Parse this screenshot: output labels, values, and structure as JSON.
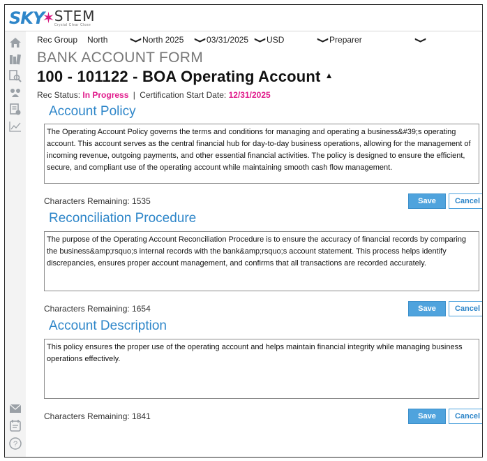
{
  "logo": {
    "sky": "SKY",
    "stem": "STEM",
    "tagline": "Crystal Clear Close"
  },
  "filters": {
    "rec_group_label": "Rec Group",
    "group": "North",
    "period": "North 2025",
    "date": "03/31/2025",
    "currency": "USD",
    "role": "Preparer"
  },
  "form": {
    "label": "BANK ACCOUNT FORM",
    "account_title": "100 - 101122 - BOA Operating Account",
    "status_label": "Rec Status:",
    "status_value": "In Progress",
    "separator": "|",
    "cert_label": "Certification Start Date:",
    "cert_value": "12/31/2025"
  },
  "sections": [
    {
      "title": "Account Policy",
      "text": "The Operating Account Policy governs the terms and conditions for managing and operating a business&#39;s operating account. This account serves as the central financial hub for day-to-day business operations, allowing for the management of incoming revenue, outgoing payments, and other essential financial activities. The policy is designed to ensure the efficient, secure, and compliant use of the operating account while maintaining smooth cash flow management.",
      "chars_remaining": "Characters Remaining: 1535"
    },
    {
      "title": "Reconciliation Procedure",
      "text": "The purpose of the Operating Account Reconciliation Procedure is to ensure the accuracy of financial records by comparing the business&amp;rsquo;s internal records with the bank&amp;rsquo;s account statement. This process helps identify discrepancies, ensures proper account management, and confirms that all transactions are recorded accurately.",
      "chars_remaining": "Characters Remaining: 1654"
    },
    {
      "title": "Account Description",
      "text": "This policy ensures the proper use of the operating account and helps maintain financial integrity while managing business operations effectively.",
      "chars_remaining": "Characters Remaining: 1841"
    }
  ],
  "buttons": {
    "save": "Save",
    "cancel": "Cancel"
  },
  "colors": {
    "accent": "#2e86c9",
    "status_pink": "#e0188a",
    "save_bg": "#4fa3dd"
  },
  "icons": [
    "home-icon",
    "library-icon",
    "search-report-icon",
    "people-icon",
    "document-check-icon",
    "chart-icon",
    "mail-icon",
    "calendar-icon",
    "help-icon"
  ]
}
